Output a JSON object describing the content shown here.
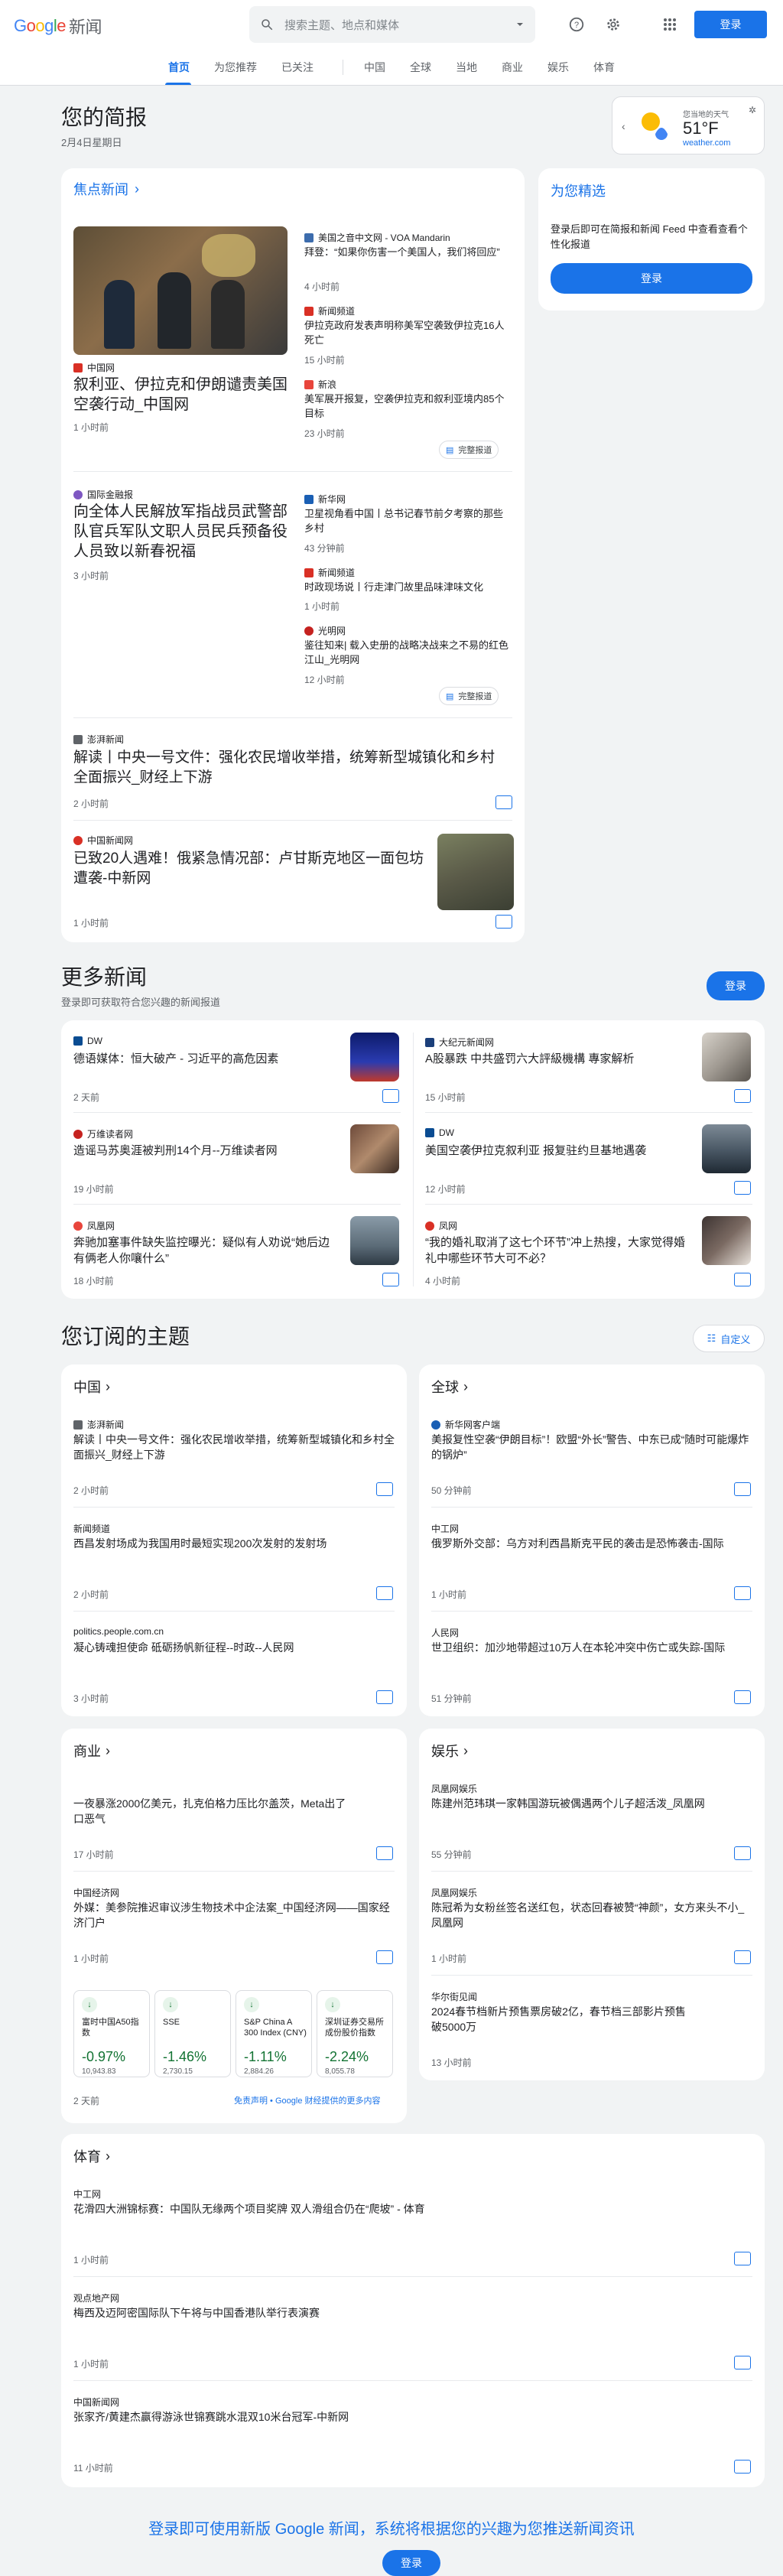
{
  "header": {
    "logo_google": "Google",
    "logo_product": "新闻",
    "search_placeholder": "搜索主题、地点和媒体",
    "signin": "登录"
  },
  "nav": {
    "items": [
      "首页",
      "为您推荐",
      "已关注",
      "中国",
      "全球",
      "当地",
      "商业",
      "娱乐",
      "体育"
    ]
  },
  "briefing": {
    "title": "您的简报",
    "date": "2月4日星期日"
  },
  "weather": {
    "label": "您当地的天气",
    "temp": "51°F",
    "source": "weather.com"
  },
  "headlines": {
    "title": "焦点新闻",
    "full_coverage": "完整报道",
    "cluster1": {
      "main": {
        "source": "中国网",
        "title": "叙利亚、伊拉克和伊朗谴责美国空袭行动_中国网",
        "time": "1 小时前"
      },
      "side": [
        {
          "source": "美国之音中文网 - VOA Mandarin",
          "title": "拜登：“如果你伤害一个美国人，我们将回应”",
          "time": "4 小时前"
        },
        {
          "source": "新闻频道",
          "title": "伊拉克政府发表声明称美军空袭致伊拉克16人死亡",
          "time": "15 小时前"
        },
        {
          "source": "新浪",
          "title": "美军展开报复，空袭伊拉克和叙利亚境内85个目标",
          "time": "23 小时前"
        }
      ]
    },
    "cluster2": {
      "main": {
        "source": "国际金融报",
        "title": "向全体人民解放军指战员武警部队官兵军队文职人员民兵预备役人员致以新春祝福",
        "time": "3 小时前"
      },
      "side": [
        {
          "source": "新华网",
          "title": "卫星视角看中国丨总书记春节前夕考察的那些乡村",
          "time": "43 分钟前"
        },
        {
          "source": "新闻频道",
          "title": "时政现场说丨行走津门故里品味津味文化",
          "time": "1 小时前"
        },
        {
          "source": "光明网",
          "title": "鉴往知来| 载入史册的战略决战来之不易的红色江山_光明网",
          "time": "12 小时前"
        }
      ]
    },
    "single1": {
      "source": "澎湃新闻",
      "title": "解读丨中央一号文件：强化农民增收举措，统筹新型城镇化和乡村全面振兴_财经上下游",
      "time": "2 小时前"
    },
    "single2": {
      "source": "中国新闻网",
      "title": "已致20人遇难！俄紧急情况部：卢甘斯克地区一面包坊遭袭-中新网",
      "time": "1 小时前"
    }
  },
  "picks": {
    "title": "为您精选",
    "desc": "登录后即可在简报和新闻 Feed 中查看查看个性化报道",
    "signin": "登录"
  },
  "more": {
    "title": "更多新闻",
    "sub": "登录即可获取符合您兴趣的新闻报道",
    "signin": "登录",
    "items": [
      {
        "source": "DW",
        "title": "德语媒体：恒大破产 - 习近平的高危因素",
        "time": "2 天前"
      },
      {
        "source": "大纪元新闻网",
        "title": "A股暴跌 中共盛罚六大評級機構 專家解析",
        "time": "15 小时前"
      },
      {
        "source": "万维读者网",
        "title": "造谣马苏奥涯被判刑14个月--万维读者网",
        "time": "19 小时前"
      },
      {
        "source": "DW",
        "title": "美国空袭伊拉克叙利亚 报复驻约旦基地遇袭",
        "time": "12 小时前"
      },
      {
        "source": "凤凰网",
        "title": "奔驰加塞事件缺失监控曝光：疑似有人劝说“她后边有俩老人你嚷什么”",
        "time": "18 小时前"
      },
      {
        "source": "凤网",
        "title": "“我的婚礼取消了这七个环节”冲上热搜，大家觉得婚礼中哪些环节大可不必？",
        "time": "4 小时前"
      }
    ]
  },
  "topics": {
    "title": "您订阅的主题",
    "customize": "自定义",
    "china": {
      "title": "中国",
      "items": [
        {
          "source": "澎湃新闻",
          "title": "解读丨中央一号文件：强化农民增收举措，统筹新型城镇化和乡村全面振兴_财经上下游",
          "time": "2 小时前"
        },
        {
          "source": "新闻频道",
          "title": "西昌发射场成为我国用时最短实现200次发射的发射场",
          "time": "2 小时前"
        },
        {
          "source": "politics.people.com.cn",
          "title": "凝心铸魂担使命 砥砺扬帆新征程--时政--人民网",
          "time": "3 小时前"
        }
      ]
    },
    "world": {
      "title": "全球",
      "items": [
        {
          "source": "新华网客户端",
          "title": "美报复性空袭“伊朗目标”！欧盟“外长”警告、中东已成“随时可能爆炸的锅炉”",
          "time": "50 分钟前"
        },
        {
          "source": "中工网",
          "title": "俄罗斯外交部：乌方对利西昌斯克平民的袭击是恐怖袭击-国际",
          "time": "1 小时前"
        },
        {
          "source": "人民网",
          "title": "世卫组织：加沙地带超过10万人在本轮冲突中伤亡或失踪-国际",
          "time": "51 分钟前"
        }
      ]
    },
    "business": {
      "title": "商业",
      "items": [
        {
          "source": "",
          "title": "一夜暴涨2000亿美元，扎克伯格力压比尔盖茨，Meta出了口恶气",
          "time": "17 小时前"
        },
        {
          "source": "中国经济网",
          "title": "外媒：美参院推迟审议涉生物技术中企法案_中国经济网——国家经济门户",
          "time": "1 小时前"
        }
      ],
      "stocks": [
        {
          "name": "富时中国A50指数",
          "pct": "-0.97%",
          "val": "10,943.83"
        },
        {
          "name": "SSE",
          "pct": "-1.46%",
          "val": "2,730.15"
        },
        {
          "name": "S&P China A 300 Index (CNY)",
          "pct": "-1.11%",
          "val": "2,884.26"
        },
        {
          "name": "深圳证券交易所成份股价指数",
          "pct": "-2.24%",
          "val": "8,055.78"
        }
      ],
      "stocks_time": "2 天前",
      "disclaimer": "免责声明 • Google 财经提供的更多内容"
    },
    "ent": {
      "title": "娱乐",
      "items": [
        {
          "source": "凤凰网娱乐",
          "title": "陈建州范玮琪一家韩国游玩被偶遇两个儿子超活泼_凤凰网",
          "time": "55 分钟前"
        },
        {
          "source": "凤凰网娱乐",
          "title": "陈冠希为女粉丝签名送红包，状态回春被赞“神颜”，女方来头不小_凤凰网",
          "time": "1 小时前"
        },
        {
          "source": "华尔街见闻",
          "title": "2024春节档新片预售票房破2亿，春节档三部影片预售破5000万",
          "time": "13 小时前"
        }
      ]
    },
    "sports": {
      "title": "体育",
      "items": [
        {
          "source": "中工网",
          "title": "花滑四大洲锦标赛：中国队无缘两个项目奖牌 双人滑组合仍在“爬坡” - 体育",
          "time": "1 小时前"
        },
        {
          "source": "观点地产网",
          "title": "梅西及迈阿密国际队下午将与中国香港队举行表演赛",
          "time": "1 小时前"
        },
        {
          "source": "中国新闻网",
          "title": "张家齐/黄建杰赢得游泳世锦赛跳水混双10米台冠军-中新网",
          "time": "11 小时前"
        }
      ]
    }
  },
  "footer": {
    "promo": "登录即可使用新版 Google 新闻，系统将根据您的兴趣为您推送新闻资讯",
    "signin": "登录"
  },
  "colors": {
    "accent": "#1a73e8",
    "down": "#137333"
  }
}
